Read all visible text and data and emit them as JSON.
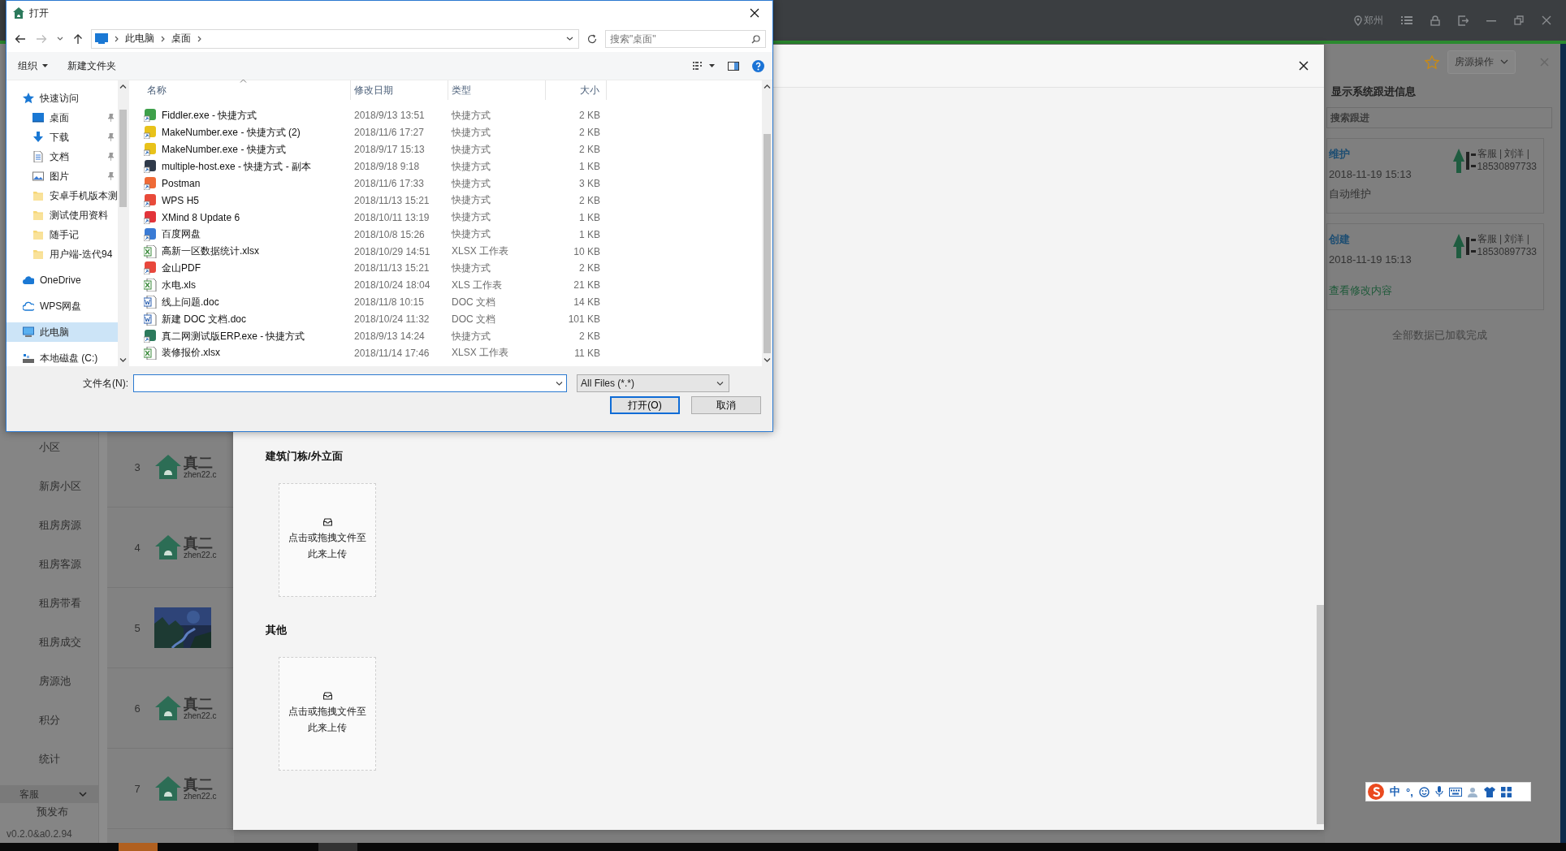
{
  "app": {
    "location": "郑州",
    "sidebar": [
      "小区",
      "新房小区",
      "租房房源",
      "租房客源",
      "租房带看",
      "租房成交",
      "房源池",
      "积分",
      "统计"
    ],
    "sidebar_group": {
      "label": "客服",
      "expanded": true,
      "items": [
        "预发布"
      ]
    },
    "version": "v0.2.0&a0.2.94",
    "rows": [
      {
        "number": "3",
        "kind": "logo",
        "brand": "真二",
        "domain": "zhen22.c"
      },
      {
        "number": "4",
        "kind": "logo",
        "brand": "真二",
        "domain": "zhen22.c"
      },
      {
        "number": "5",
        "kind": "picture"
      },
      {
        "number": "6",
        "kind": "logo",
        "brand": "真二",
        "domain": "zhen22.c"
      },
      {
        "number": "7",
        "kind": "logo",
        "brand": "真二",
        "domain": "zhen22.c"
      }
    ],
    "detail_panel": {
      "action_menu": "房源操作",
      "show_system_label": "显示系统跟进信息",
      "search": {
        "placeholder": "搜索跟进"
      },
      "records": [
        {
          "title": "维护",
          "time": "2018-11-19 15:13",
          "note": "自动维护",
          "author": "客服 | 刘洋 |",
          "phone": "18530897733"
        },
        {
          "title": "创建",
          "time": "2018-11-19 15:13",
          "link": "查看修改内容",
          "author": "客服 | 刘洋 |",
          "phone": "18530897733"
        }
      ],
      "footer": "全部数据已加载完成"
    }
  },
  "modal": {
    "sections": [
      {
        "title": "建筑门栋/外立面",
        "upload_hint": "点击或拖拽文件至此来上传"
      },
      {
        "title": "其他",
        "upload_hint": "点击或拖拽文件至此来上传"
      }
    ]
  },
  "file_dialog": {
    "title": "打开",
    "path": [
      "此电脑",
      "桌面"
    ],
    "search": {
      "placeholder": "搜索\"桌面\""
    },
    "toolbar": [
      "组织",
      "新建文件夹"
    ],
    "nav": [
      {
        "label": "快速访问",
        "kind": "quick-access",
        "pinned": false,
        "selected": false
      },
      {
        "label": "桌面",
        "kind": "desktop",
        "pinned": true,
        "selected": false
      },
      {
        "label": "下载",
        "kind": "downloads",
        "pinned": true,
        "selected": false
      },
      {
        "label": "文档",
        "kind": "documents",
        "pinned": true,
        "selected": false
      },
      {
        "label": "图片",
        "kind": "pictures",
        "pinned": true,
        "selected": false
      },
      {
        "label": "安卓手机版本测",
        "kind": "folder",
        "pinned": false,
        "selected": false
      },
      {
        "label": "测试使用资料",
        "kind": "folder",
        "pinned": false,
        "selected": false
      },
      {
        "label": "随手记",
        "kind": "folder",
        "pinned": false,
        "selected": false
      },
      {
        "label": "用户端-迭代94",
        "kind": "folder",
        "pinned": false,
        "selected": false
      },
      {
        "label": "OneDrive",
        "kind": "onedrive",
        "pinned": false,
        "selected": false
      },
      {
        "label": "WPS网盘",
        "kind": "wps-cloud",
        "pinned": false,
        "selected": false
      },
      {
        "label": "此电脑",
        "kind": "this-pc",
        "pinned": false,
        "selected": true
      },
      {
        "label": "本地磁盘 (C:)",
        "kind": "drive",
        "pinned": false,
        "selected": false
      }
    ],
    "columns": [
      "名称",
      "修改日期",
      "类型",
      "大小"
    ],
    "files": [
      {
        "name": "Fiddler.exe - 快捷方式",
        "modified": "2018/9/13 13:51",
        "type": "快捷方式",
        "size": "2 KB",
        "kind": "app"
      },
      {
        "name": "MakeNumber.exe - 快捷方式 (2)",
        "modified": "2018/11/6 17:27",
        "type": "快捷方式",
        "size": "2 KB",
        "kind": "app"
      },
      {
        "name": "MakeNumber.exe - 快捷方式",
        "modified": "2018/9/17 15:13",
        "type": "快捷方式",
        "size": "2 KB",
        "kind": "app"
      },
      {
        "name": "multiple-host.exe - 快捷方式 - 副本",
        "modified": "2018/9/18 9:18",
        "type": "快捷方式",
        "size": "1 KB",
        "kind": "app"
      },
      {
        "name": "Postman",
        "modified": "2018/11/6 17:33",
        "type": "快捷方式",
        "size": "3 KB",
        "kind": "app"
      },
      {
        "name": "WPS H5",
        "modified": "2018/11/13 15:21",
        "type": "快捷方式",
        "size": "2 KB",
        "kind": "app"
      },
      {
        "name": "XMind 8 Update 6",
        "modified": "2018/10/11 13:19",
        "type": "快捷方式",
        "size": "1 KB",
        "kind": "app"
      },
      {
        "name": "百度网盘",
        "modified": "2018/10/8 15:26",
        "type": "快捷方式",
        "size": "1 KB",
        "kind": "app"
      },
      {
        "name": "高新一区数据统计.xlsx",
        "modified": "2018/10/29 14:51",
        "type": "XLSX 工作表",
        "size": "10 KB",
        "kind": "sheet"
      },
      {
        "name": "金山PDF",
        "modified": "2018/11/13 15:21",
        "type": "快捷方式",
        "size": "2 KB",
        "kind": "app"
      },
      {
        "name": "水电.xls",
        "modified": "2018/10/24 18:04",
        "type": "XLS 工作表",
        "size": "21 KB",
        "kind": "sheet"
      },
      {
        "name": "线上问题.doc",
        "modified": "2018/11/8 10:15",
        "type": "DOC 文档",
        "size": "14 KB",
        "kind": "doc"
      },
      {
        "name": "新建 DOC 文档.doc",
        "modified": "2018/10/24 11:32",
        "type": "DOC 文档",
        "size": "101 KB",
        "kind": "doc"
      },
      {
        "name": "真二网测试版ERP.exe - 快捷方式",
        "modified": "2018/9/13 14:24",
        "type": "快捷方式",
        "size": "2 KB",
        "kind": "app"
      },
      {
        "name": "装修报价.xlsx",
        "modified": "2018/11/14 17:46",
        "type": "XLSX 工作表",
        "size": "11 KB",
        "kind": "sheet"
      }
    ],
    "filename_label": "文件名(N):",
    "filter": "All Files (*.*)",
    "buttons": [
      {
        "label": "打开(O)",
        "default": true
      },
      {
        "label": "取消",
        "default": false
      }
    ]
  },
  "ime_bar": [
    "中",
    "°,"
  ]
}
